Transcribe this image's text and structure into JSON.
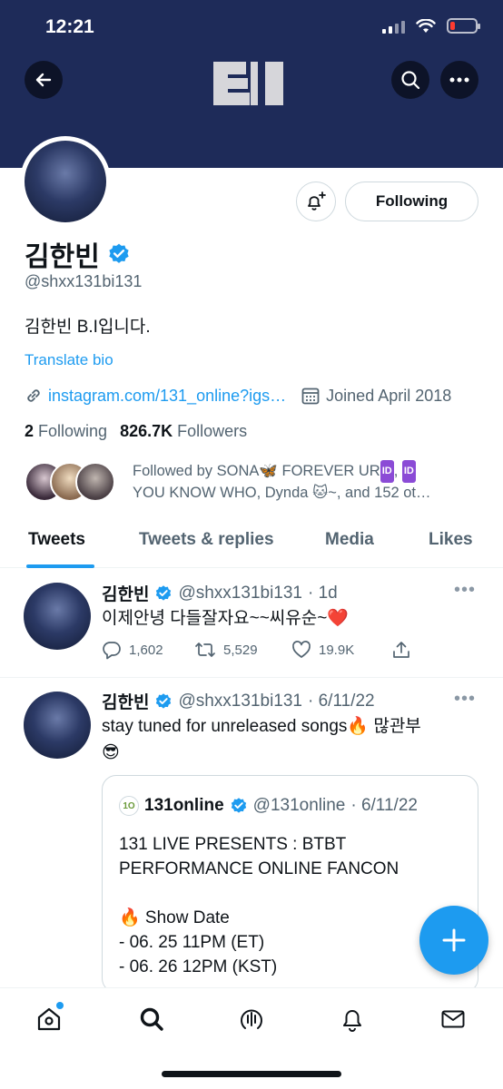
{
  "status_bar": {
    "time": "12:21"
  },
  "header": {
    "logo_text": "B.I"
  },
  "profile": {
    "name": "김한빈",
    "handle": "@shxx131bi131",
    "bio": "김한빈 B.I입니다.",
    "translate_label": "Translate bio",
    "link": "instagram.com/131_online?igs…",
    "joined": "Joined April 2018",
    "following_count": "2",
    "following_label": "Following",
    "followers_count": "826.7K",
    "followers_label": "Followers",
    "following_button": "Following",
    "followed_by_line1": "Followed by SONA🦋 FOREVER UR",
    "followed_by_line2": "YOU KNOW WHO, Dynda 🐱~, and 152 ot…",
    "id_badge": "ID"
  },
  "tabs": [
    "Tweets",
    "Tweets & replies",
    "Media",
    "Likes"
  ],
  "tweets": [
    {
      "name": "김한빈",
      "handle": "@shxx131bi131",
      "time": "· 1d",
      "text": "이제안녕 다들잘자요~~씨유순~❤️",
      "replies": "1,602",
      "retweets": "5,529",
      "likes": "19.9K"
    },
    {
      "name": "김한빈",
      "handle": "@shxx131bi131",
      "time": "· 6/11/22",
      "text_line1": "stay tuned for unreleased songs🔥 많관부",
      "text_line2": "😎",
      "quote": {
        "name": "131online",
        "handle": "@131online",
        "time": "· 6/11/22",
        "line1": "131 LIVE PRESENTS : BTBT",
        "line2": "PERFORMANCE ONLINE FANCON",
        "line3": "🔥 Show Date",
        "line4": "- 06. 25 11PM (ET)",
        "line5": "- 06. 26 12PM (KST)"
      }
    }
  ],
  "colors": {
    "banner": "#1e2b59",
    "accent": "#1d9bf0"
  }
}
